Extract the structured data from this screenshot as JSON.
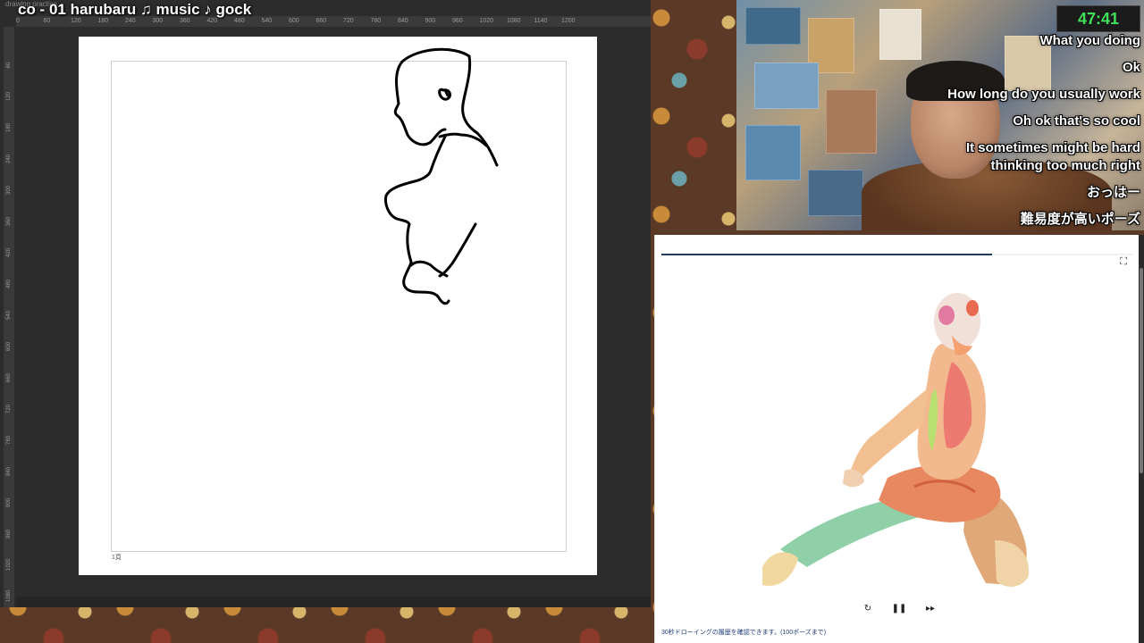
{
  "stream": {
    "title_text": "co - 01 harubaru    ♫ music ♪ gock",
    "faint_tab": "drawing practice"
  },
  "ruler": {
    "top_ticks": [
      "0",
      "60",
      "120",
      "180",
      "240",
      "300",
      "360",
      "420",
      "480",
      "540",
      "600",
      "660",
      "720",
      "780",
      "840",
      "900",
      "960",
      "1020",
      "1080",
      "1140",
      "1200"
    ],
    "left_ticks": [
      "60",
      "120",
      "180",
      "240",
      "300",
      "360",
      "420",
      "480",
      "540",
      "600",
      "660",
      "720",
      "780",
      "840",
      "900",
      "960",
      "1020",
      "1080"
    ]
  },
  "canvas": {
    "page_label": "1頁"
  },
  "webcam": {
    "timer": "47:41",
    "chat": [
      "What you doing",
      "Ok",
      "How long do you usually work",
      "Oh ok that's so cool",
      "It sometimes might be hard thinking too much right",
      "おっはー",
      "難易度が高いポーズ"
    ]
  },
  "reference": {
    "progress": 0.7,
    "note": "30秒ドローイングの履歴を確認できます。(100ポーズまで)",
    "controls": {
      "restart_icon": "restart-icon",
      "pause_icon": "pause-icon",
      "skip_icon": "skip-icon"
    }
  }
}
